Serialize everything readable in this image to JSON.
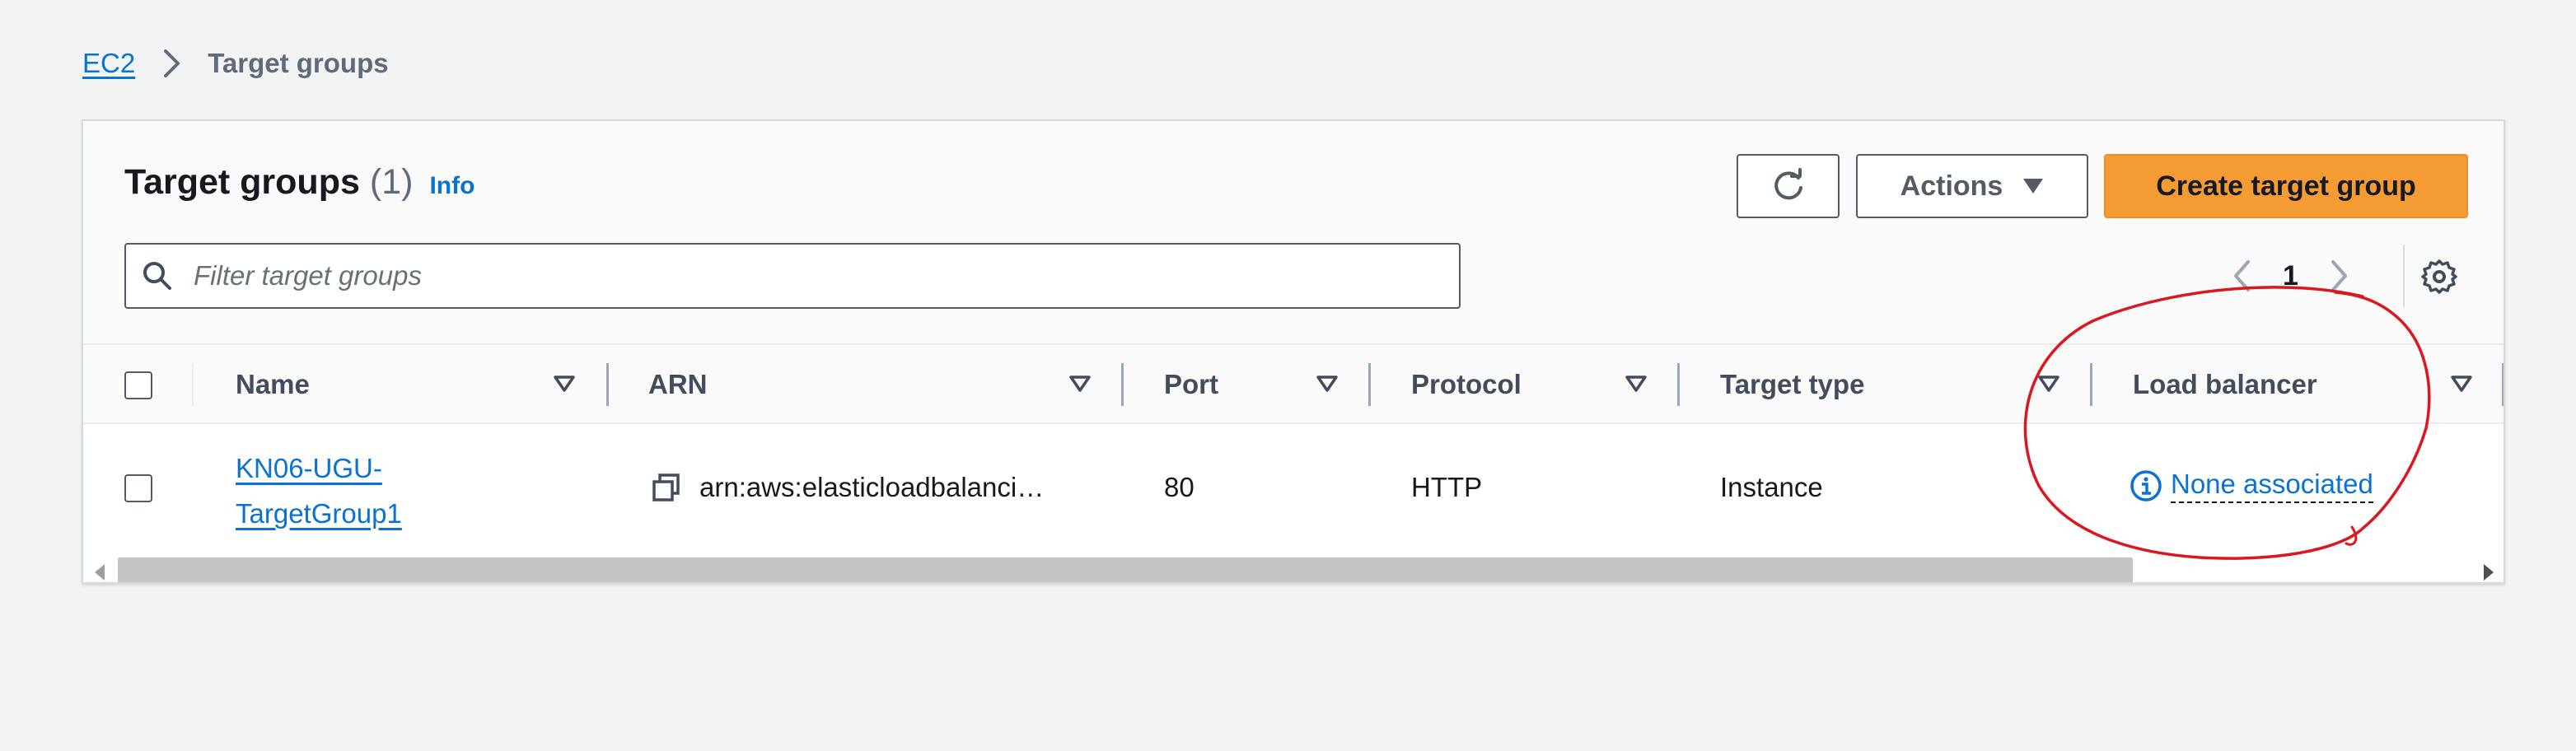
{
  "breadcrumb": {
    "root": "EC2",
    "current": "Target groups"
  },
  "panel": {
    "title": "Target groups",
    "count": "(1)",
    "info_link": "Info"
  },
  "toolbar": {
    "refresh_icon": "refresh-icon",
    "actions_label": "Actions",
    "create_label": "Create target group"
  },
  "filter": {
    "placeholder": "Filter target groups",
    "icon": "search-icon"
  },
  "pagination": {
    "page": "1"
  },
  "table": {
    "columns": [
      "Name",
      "ARN",
      "Port",
      "Protocol",
      "Target type",
      "Load balancer"
    ],
    "rows": [
      {
        "name_line1": "KN06-UGU-",
        "name_line2": "TargetGroup1",
        "arn": "arn:aws:elasticloadbalanci…",
        "port": "80",
        "protocol": "HTTP",
        "target_type": "Instance",
        "load_balancer": "None associated"
      }
    ]
  },
  "colors": {
    "link": "#0972d3",
    "primary_button": "#f49b34",
    "annotation": "#d9181f"
  }
}
